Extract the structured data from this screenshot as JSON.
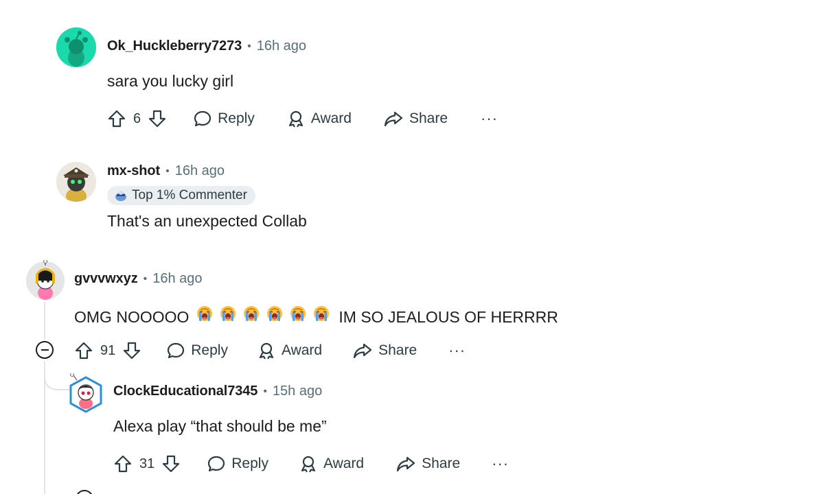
{
  "comments": [
    {
      "username": "Ok_Huckleberry7273",
      "time": "16h ago",
      "text": "sara you lucky girl",
      "votes": "6",
      "avatar": "snoo-teal-avatar"
    },
    {
      "username": "mx-shot",
      "time": "16h ago",
      "flair": "Top 1% Commenter",
      "text": "That's an unexpected Collab",
      "avatar": "snoo-hat-avatar"
    },
    {
      "username": "gvvvwxyz",
      "time": "16h ago",
      "text_before": "OMG NOOOOO",
      "emoji_count": 6,
      "emoji_name": "loudly-crying-face",
      "text_after": "IM SO JEALOUS OF HERRRR",
      "votes": "91",
      "avatar": "snoo-pink-avatar"
    },
    {
      "username": "ClockEducational7345",
      "time": "15h ago",
      "text": "Alexa play “that should be me”",
      "votes": "31",
      "avatar": "snoo-white-avatar"
    }
  ],
  "actions": {
    "reply": "Reply",
    "award": "Award",
    "share": "Share",
    "more": "···",
    "separator": "•"
  },
  "colors": {
    "text": "#1c1c1c",
    "meta": "#576f76",
    "action": "#2a3c42",
    "flair_bg": "#eaeef0",
    "thread_line": "#dfe4e6",
    "teal_avatar": "#1ad9ab"
  },
  "icons": [
    "upvote-icon",
    "downvote-icon",
    "reply-icon",
    "award-icon",
    "share-icon",
    "more-icon",
    "collapse-icon",
    "flair-icon"
  ]
}
